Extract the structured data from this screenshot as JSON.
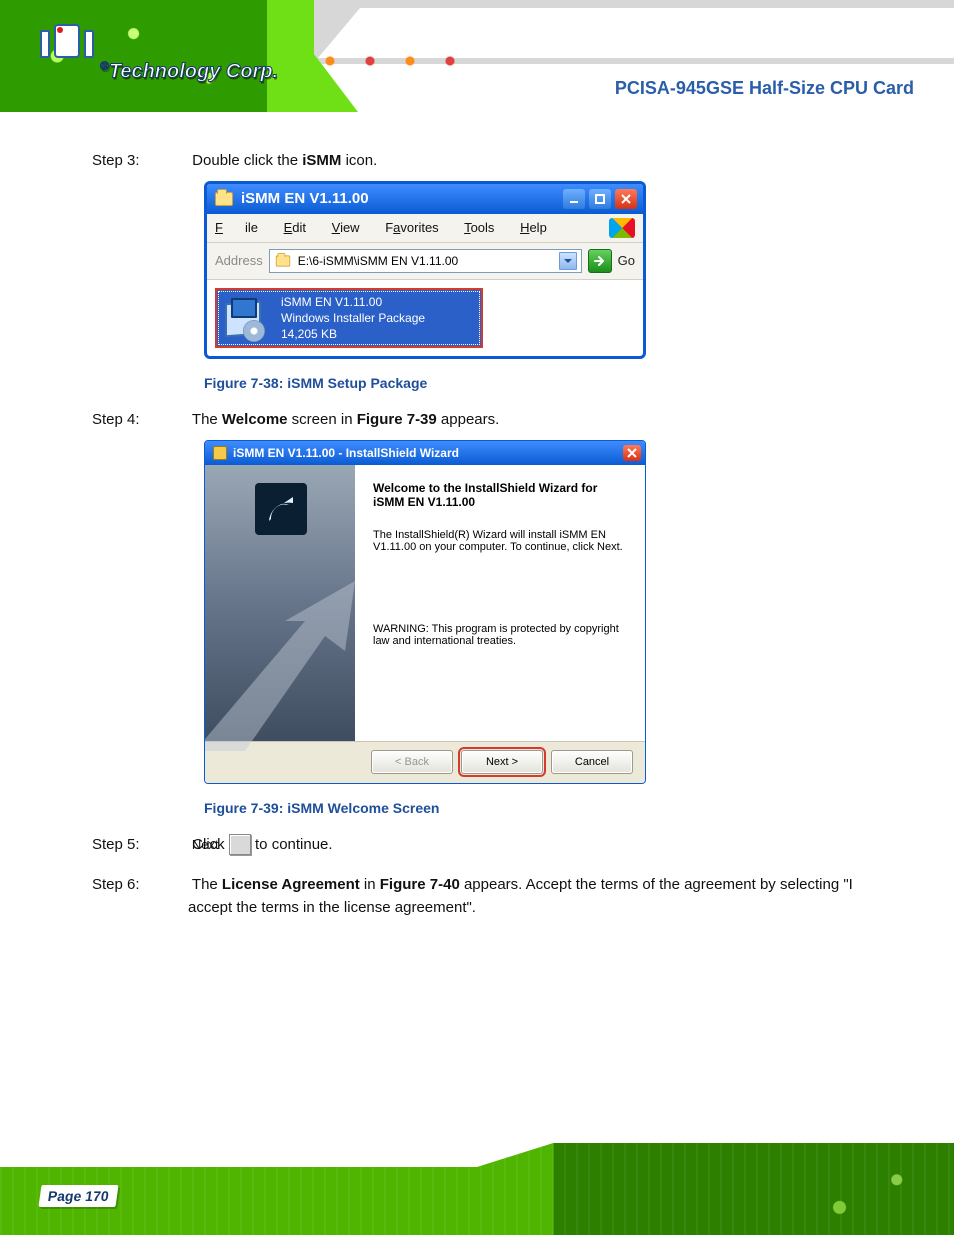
{
  "header": {
    "trademark_prefix": "®",
    "trademark_text": "Technology Corp.",
    "model": "PCISA-945GSE Half-Size CPU Card"
  },
  "content": {
    "step3": {
      "num": "Step 3:",
      "text_before_bold": "Double click the ",
      "bold": "iSMM",
      "text_after_bold": " icon."
    },
    "figure3": "Figure 7-38: iSMM Setup Package",
    "step4": "Step 4:  The Welcome screen in Figure 7-39 appears.",
    "figure4": "Figure 7-39: iSMM Welcome Screen",
    "step5": {
      "num": "Step 5:",
      "text_before_key": "Click ",
      "key": "Next",
      "text_after_key": " to continue."
    },
    "step6": {
      "num": "Step 6:",
      "text_before_bold": "The ",
      "bold": "License Agreement",
      "text_after_bold": " in ",
      "xref": "Figure 7-40",
      "text_tail": " appears. Accept the terms of the agreement by selecting \"I accept the terms in the license agreement\"."
    }
  },
  "explorer": {
    "title": "iSMM EN V1.11.00",
    "menu": {
      "file": "File",
      "edit": "Edit",
      "view": "View",
      "favorites": "Favorites",
      "tools": "Tools",
      "help": "Help"
    },
    "address_label": "Address",
    "address_value": "E:\\6-iSMM\\iSMM EN V1.11.00",
    "go": "Go",
    "file": {
      "name": "iSMM EN V1.11.00",
      "type": "Windows Installer Package",
      "size": "14,205 KB"
    }
  },
  "wizard": {
    "title": "iSMM EN V1.11.00 - InstallShield Wizard",
    "welcome": "Welcome to the InstallShield Wizard for iSMM EN V1.11.00",
    "para1": "The InstallShield(R) Wizard will install iSMM EN V1.11.00 on your computer. To continue, click Next.",
    "warning": "WARNING: This program is protected by copyright law and international treaties.",
    "back": "< Back",
    "next": "Next >",
    "cancel": "Cancel"
  },
  "footer": {
    "page": "Page 170"
  }
}
